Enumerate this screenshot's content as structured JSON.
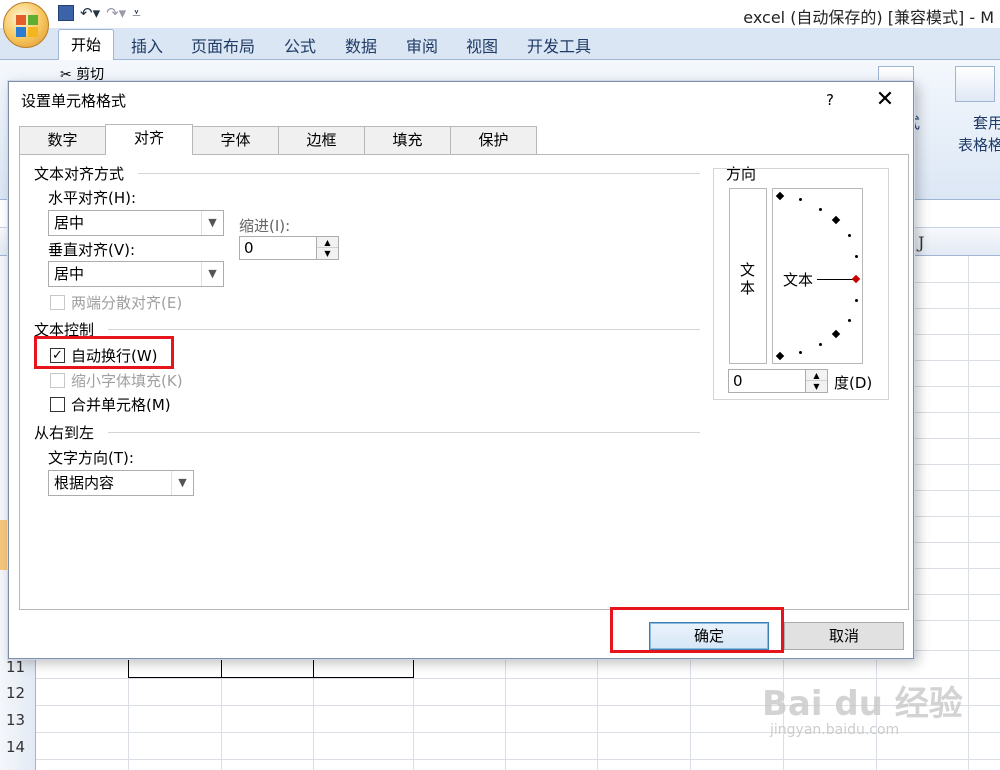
{
  "app": {
    "window_title": "excel (自动保存的) [兼容模式] - M",
    "ribbon_tabs": [
      "开始",
      "插入",
      "页面布局",
      "公式",
      "数据",
      "审阅",
      "视图",
      "开发工具"
    ],
    "cut_label": "剪切",
    "ribbon_right_1": "式",
    "ribbon_right_2": "套用\n表格格式",
    "column_header_J": "J",
    "row_numbers": [
      "11",
      "12",
      "13",
      "14"
    ]
  },
  "dialog": {
    "title": "设置单元格格式",
    "help": "?",
    "close": "✕",
    "tabs": [
      "数字",
      "对齐",
      "字体",
      "边框",
      "填充",
      "保护"
    ],
    "active_tab": "对齐",
    "text_align_section": "文本对齐方式",
    "horizontal_label": "水平对齐(H):",
    "horizontal_value": "居中",
    "indent_label": "缩进(I):",
    "indent_value": "0",
    "vertical_label": "垂直对齐(V):",
    "vertical_value": "居中",
    "justify_distributed": "两端分散对齐(E)",
    "text_control_section": "文本控制",
    "wrap_text": "自动换行(W)",
    "wrap_text_checked": true,
    "shrink_to_fit": "缩小字体填充(K)",
    "merge_cells": "合并单元格(M)",
    "rtl_section": "从右到左",
    "text_direction_label": "文字方向(T):",
    "text_direction_value": "根据内容",
    "orientation_section": "方向",
    "orientation_vertical_text": "文本",
    "orientation_dial_text": "文本",
    "degree_value": "0",
    "degree_label": "度(D)",
    "ok": "确定",
    "cancel": "取消"
  },
  "watermark": {
    "text": "Bai du 经验",
    "sub": "jingyan.baidu.com"
  },
  "colors": {
    "highlight": "#e8141d",
    "ribbon": "#dbe6f4",
    "knob": "#cc0000"
  }
}
